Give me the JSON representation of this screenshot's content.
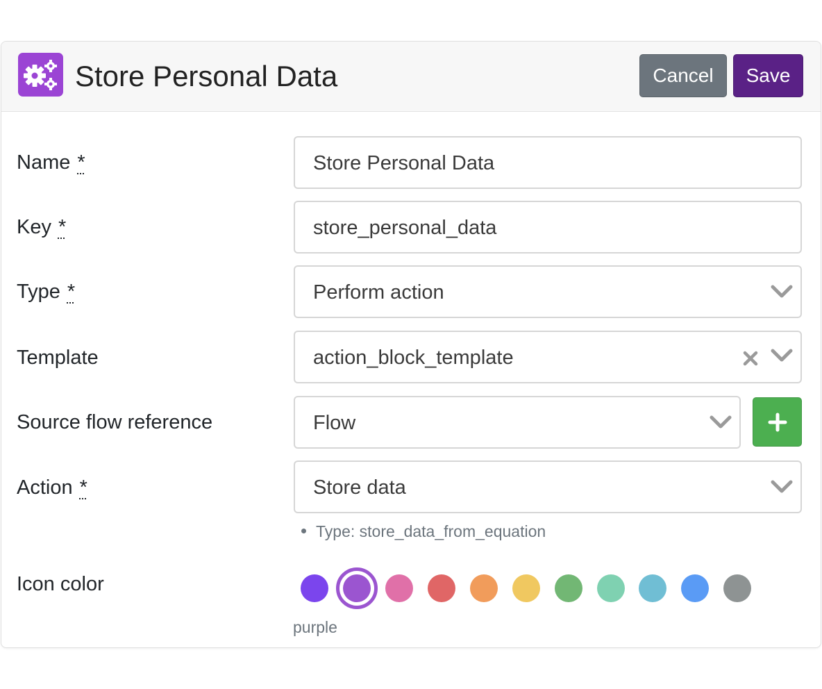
{
  "header": {
    "title": "Store Personal Data",
    "icon": "gears-icon",
    "cancel_label": "Cancel",
    "save_label": "Save"
  },
  "form": {
    "name": {
      "label": "Name",
      "required_mark": "*",
      "value": "Store Personal Data"
    },
    "key": {
      "label": "Key",
      "required_mark": "*",
      "value": "store_personal_data"
    },
    "type": {
      "label": "Type",
      "required_mark": "*",
      "value": "Perform action"
    },
    "template": {
      "label": "Template",
      "value": "action_block_template"
    },
    "source_flow": {
      "label": "Source flow reference",
      "value": "Flow"
    },
    "action": {
      "label": "Action",
      "required_mark": "*",
      "value": "Store data",
      "hint": "Type: store_data_from_equation"
    },
    "icon_color": {
      "label": "Icon color",
      "selected_name": "purple",
      "swatches": [
        {
          "name": "violet",
          "hex": "#7b45ed"
        },
        {
          "name": "purple",
          "hex": "#9b55d0"
        },
        {
          "name": "pink",
          "hex": "#e070a8"
        },
        {
          "name": "red",
          "hex": "#e06666"
        },
        {
          "name": "orange",
          "hex": "#f19c5b"
        },
        {
          "name": "yellow",
          "hex": "#f0c860"
        },
        {
          "name": "green",
          "hex": "#72b774"
        },
        {
          "name": "teal",
          "hex": "#7fd1b1"
        },
        {
          "name": "cyan",
          "hex": "#70bed4"
        },
        {
          "name": "blue",
          "hex": "#5a9bf5"
        },
        {
          "name": "gray",
          "hex": "#8e9393"
        }
      ]
    }
  },
  "colors": {
    "brand": "#9b44d4",
    "save": "#5a2186",
    "cancel": "#6c757d",
    "add": "#4caf50"
  }
}
